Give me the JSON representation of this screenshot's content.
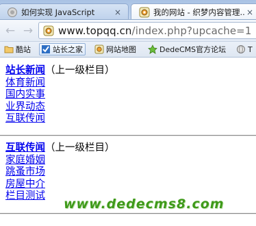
{
  "browser": {
    "tabs": [
      {
        "title": "如何实现 JavaScript",
        "close": "×",
        "active": false
      },
      {
        "title": "我的网站 - 织梦内容管理...",
        "close": "×",
        "active": true
      }
    ],
    "nav": {
      "back": "←",
      "forward": "→"
    },
    "address": {
      "host": "www.topqq.cn",
      "path": "/index.php?upcache=1"
    },
    "bookmarks": [
      {
        "label": "酷站",
        "icon": "folder-icon"
      },
      {
        "label": "站长之家",
        "icon": "chinaz-icon"
      },
      {
        "label": "网站地图",
        "icon": "dedecms-icon"
      },
      {
        "label": "DedeCMS官方论坛",
        "icon": "dede-forum-icon"
      },
      {
        "label": "T",
        "icon": "globe-icon"
      }
    ]
  },
  "page": {
    "sections": [
      {
        "heading": "站长新闻",
        "parent_label": "（上一级栏目）",
        "links": [
          "体育新闻",
          "国内实事",
          "业界动态",
          "互联传闻"
        ]
      },
      {
        "heading": "互联传闻",
        "parent_label": "（上一级栏目）",
        "links": [
          "家庭婚姻",
          "跳蚤市场",
          "房屋中介",
          "栏目测试"
        ]
      }
    ],
    "watermark": "www.dedecms8.com"
  },
  "colors": {
    "link": "#0000ee",
    "watermark": "#3f9a1a",
    "tabstrip": "#b7cdea"
  }
}
